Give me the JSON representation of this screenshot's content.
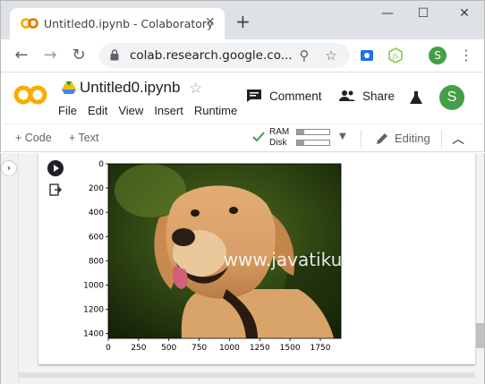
{
  "browser": {
    "tab_title": "Untitled0.ipynb - Colaboratory",
    "tab_close": "✕",
    "new_tab": "+",
    "url": "colab.research.google.co...",
    "window": {
      "minimize": "—",
      "maximize": "☐",
      "close": "✕"
    }
  },
  "colab": {
    "notebook_title": "Untitled0.ipynb",
    "menu": [
      "File",
      "Edit",
      "View",
      "Insert",
      "Runtime"
    ],
    "comment_label": "Comment",
    "share_label": "Share",
    "profile_initial": "S",
    "toolbar": {
      "add_code": "+ Code",
      "add_text": "+ Text",
      "ram_label": "RAM",
      "disk_label": "Disk",
      "ram_usage": 0.22,
      "disk_usage": 0.22,
      "editing_label": "Editing"
    }
  },
  "cell": {
    "output_image": {
      "watermark": "www.javatiku.cn",
      "subject": "golden labrador retriever dog photo"
    }
  },
  "chart_data": {
    "type": "image",
    "xlim": [
      0,
      1920
    ],
    "ylim": [
      1440,
      0
    ],
    "x_ticks": [
      "0",
      "250",
      "500",
      "750",
      "1000",
      "1250",
      "1500",
      "1750"
    ],
    "y_ticks": [
      "0",
      "200",
      "400",
      "600",
      "800",
      "1000",
      "1200",
      "1400"
    ],
    "title": "",
    "xlabel": "",
    "ylabel": ""
  },
  "colors": {
    "accent_green": "#43a047",
    "colab_orange": "#f9ab00",
    "tab_bg": "#dee1e6"
  }
}
